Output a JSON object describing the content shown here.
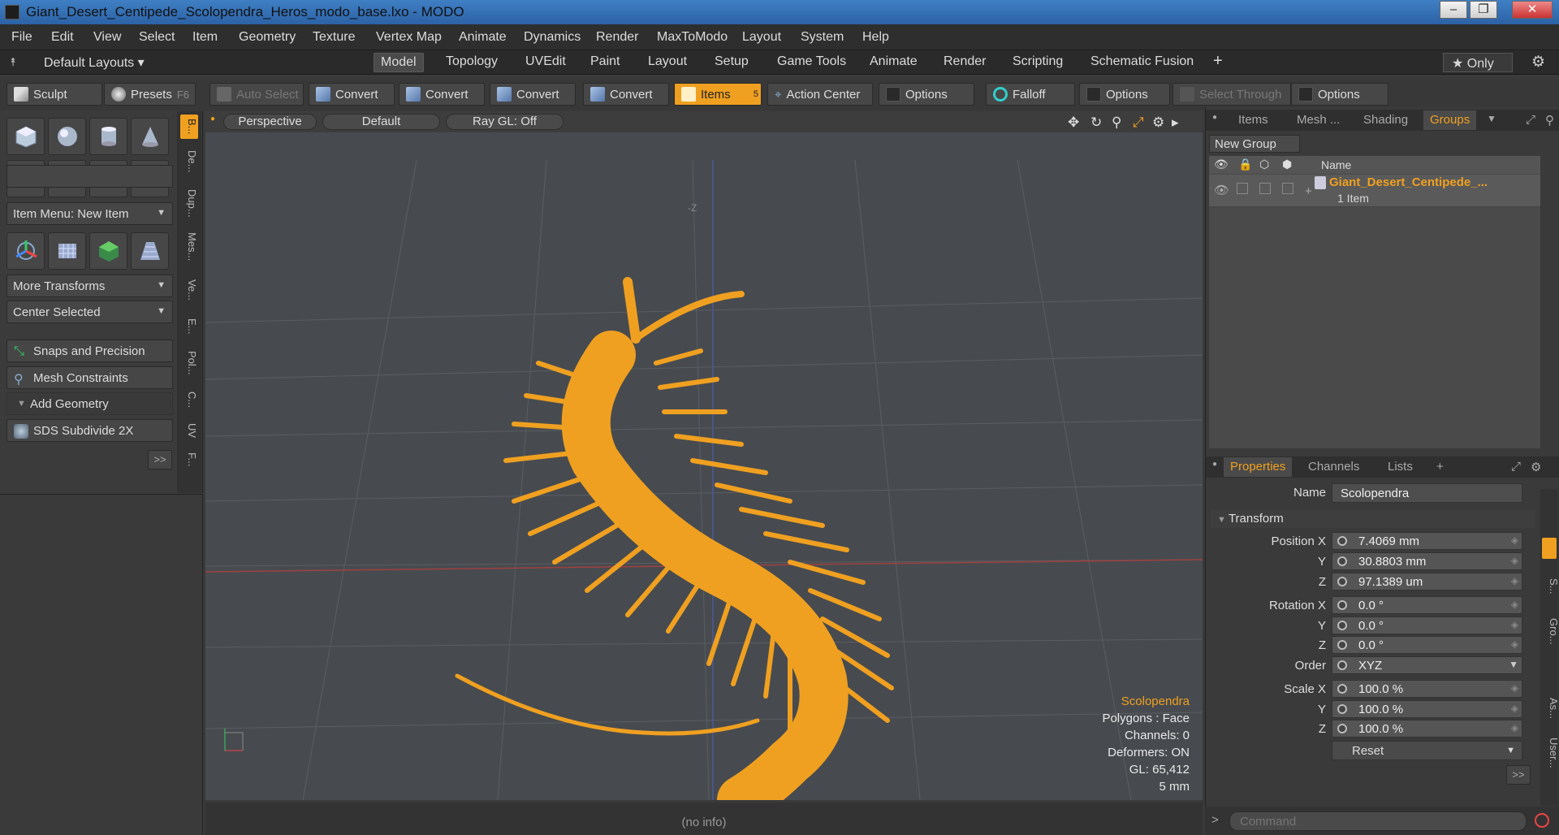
{
  "window": {
    "title": "Giant_Desert_Centipede_Scolopendra_Heros_modo_base.lxo - MODO",
    "min": "–",
    "max": "❐",
    "close": "✕"
  },
  "menu": [
    "File",
    "Edit",
    "View",
    "Select",
    "Item",
    "Geometry",
    "Texture",
    "Vertex Map",
    "Animate",
    "Dynamics",
    "Render",
    "MaxToModo",
    "Layout",
    "System",
    "Help"
  ],
  "layouts": {
    "label": "Default Layouts",
    "tabs": [
      "Model",
      "Topology",
      "UVEdit",
      "Paint",
      "Layout",
      "Setup",
      "Game Tools",
      "Animate",
      "Render",
      "Scripting",
      "Schematic Fusion"
    ],
    "add": "+",
    "only": "★ Only"
  },
  "toolbar": {
    "sculpt": "Sculpt",
    "presets": "Presets",
    "presets_key": "F6",
    "auto_select": "Auto Select",
    "convert": "Convert",
    "items": "Items",
    "items_badge": "5",
    "action_center": "Action Center",
    "options": "Options",
    "falloff": "Falloff",
    "select_through": "Select Through"
  },
  "left": {
    "item_menu": "Item Menu: New Item",
    "more_transforms": "More Transforms",
    "center_selected": "Center Selected",
    "snaps": "Snaps and Precision",
    "constraints": "Mesh Constraints",
    "add_geometry": "Add Geometry",
    "sds": "SDS Subdivide 2X",
    "more": ">>"
  },
  "vtabs": [
    "B...",
    "De...",
    "Dup...",
    "Mes...",
    "Ve...",
    "E...",
    "Pol...",
    "C...",
    "UV",
    "F..."
  ],
  "viewport": {
    "view": "Perspective",
    "shading": "Default",
    "raygl": "Ray GL: Off",
    "axis_z": "-Z",
    "hud": {
      "name": "Scolopendra",
      "polygons": "Polygons : Face",
      "channels": "Channels: 0",
      "deformers": "Deformers: ON",
      "gl": "GL: 65,412",
      "scale": "5 mm"
    }
  },
  "status": "(no info)",
  "groups": {
    "tabs": [
      "Items",
      "Mesh ...",
      "Shading",
      "Groups"
    ],
    "new_group": "New Group",
    "col_name": "Name",
    "group_name": "Giant_Desert_Centipede_...",
    "group_count": "1 Item"
  },
  "properties": {
    "tabs": [
      "Properties",
      "Channels",
      "Lists"
    ],
    "add": "+",
    "name_label": "Name",
    "name": "Scolopendra",
    "transform": "Transform",
    "position_label": "Position X",
    "pos_x": "7.4069 mm",
    "pos_y": "30.8803 mm",
    "pos_z": "97.1389 um",
    "rotation_label": "Rotation X",
    "rot_x": "0.0 °",
    "rot_y": "0.0 °",
    "rot_z": "0.0 °",
    "order_label": "Order",
    "order": "XYZ",
    "scale_label": "Scale X",
    "scale_x": "100.0 %",
    "scale_y": "100.0 %",
    "scale_z": "100.0 %",
    "y": "Y",
    "z": "Z",
    "reset": "Reset",
    "more": ">>"
  },
  "rvtabs": [
    "S...",
    "Gro...",
    "As...",
    "User..."
  ],
  "command": {
    "prompt": ">",
    "placeholder": "Command"
  },
  "colors": {
    "accent": "#f0a020",
    "mesh": "#f0a020",
    "titlebar": "#3a78c0"
  }
}
